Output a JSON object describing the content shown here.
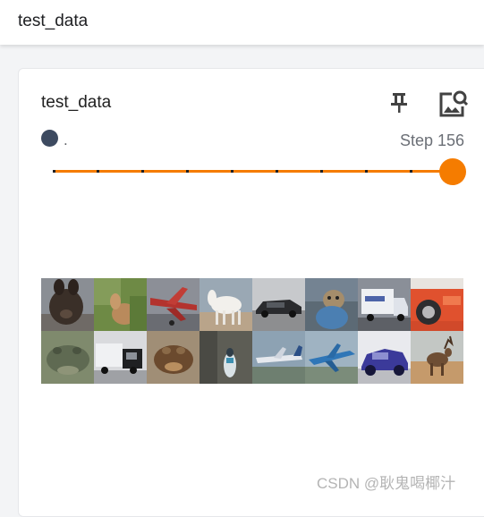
{
  "header": {
    "title": "test_data"
  },
  "card": {
    "title": "test_data",
    "actions": [
      {
        "icon": "pin-icon"
      },
      {
        "icon": "image-search-icon"
      }
    ],
    "run": {
      "label": ".",
      "color": "#3d4a60"
    },
    "step_label": "Step 156",
    "slider": {
      "accent": "#f57c00",
      "position": 1.0
    },
    "images": [
      {
        "subject": "dog"
      },
      {
        "subject": "deer"
      },
      {
        "subject": "airplane"
      },
      {
        "subject": "horse"
      },
      {
        "subject": "automobile"
      },
      {
        "subject": "cat"
      },
      {
        "subject": "truck"
      },
      {
        "subject": "automobile"
      },
      {
        "subject": "frog"
      },
      {
        "subject": "truck"
      },
      {
        "subject": "frog"
      },
      {
        "subject": "bird"
      },
      {
        "subject": "airplane"
      },
      {
        "subject": "airplane"
      },
      {
        "subject": "automobile"
      },
      {
        "subject": "deer"
      }
    ]
  },
  "watermark": "CSDN @耿鬼喝椰汁"
}
